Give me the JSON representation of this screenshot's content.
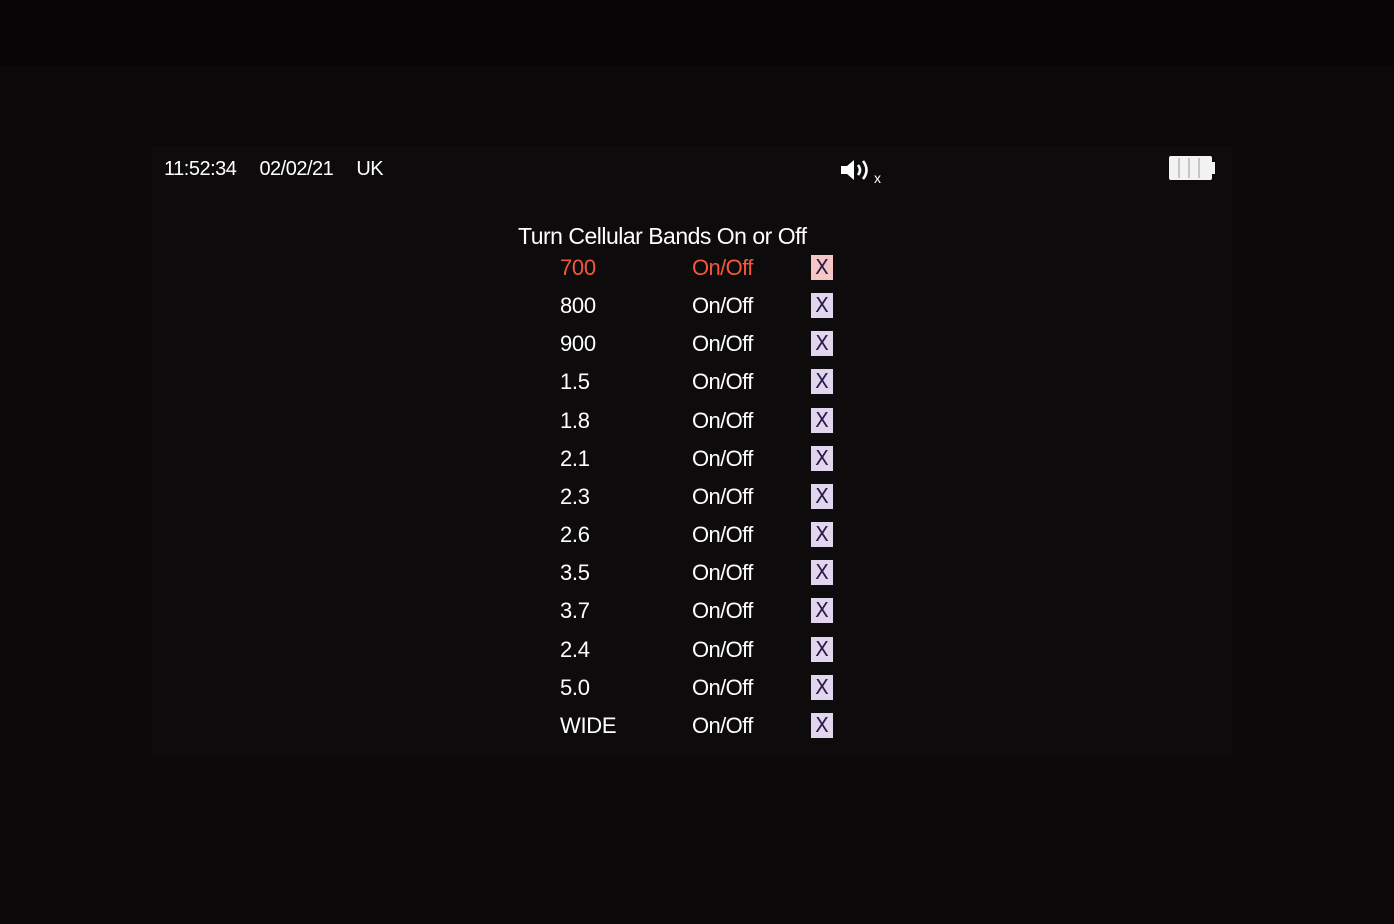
{
  "status_bar": {
    "time": "11:52:34",
    "date": "02/02/21",
    "region": "UK",
    "sound_icon": "speaker-muted-icon",
    "battery_icon": "battery-icon"
  },
  "title": "Turn Cellular Bands On or Off",
  "bands": [
    {
      "band": "700",
      "toggle": "On/Off",
      "mark": "X",
      "selected": true
    },
    {
      "band": "800",
      "toggle": "On/Off",
      "mark": "X",
      "selected": false
    },
    {
      "band": "900",
      "toggle": "On/Off",
      "mark": "X",
      "selected": false
    },
    {
      "band": "1.5",
      "toggle": "On/Off",
      "mark": "X",
      "selected": false
    },
    {
      "band": "1.8",
      "toggle": "On/Off",
      "mark": "X",
      "selected": false
    },
    {
      "band": "2.1",
      "toggle": "On/Off",
      "mark": "X",
      "selected": false
    },
    {
      "band": "2.3",
      "toggle": "On/Off",
      "mark": "X",
      "selected": false
    },
    {
      "band": "2.6",
      "toggle": "On/Off",
      "mark": "X",
      "selected": false
    },
    {
      "band": "3.5",
      "toggle": "On/Off",
      "mark": "X",
      "selected": false
    },
    {
      "band": "3.7",
      "toggle": "On/Off",
      "mark": "X",
      "selected": false
    },
    {
      "band": "2.4",
      "toggle": "On/Off",
      "mark": "X",
      "selected": false
    },
    {
      "band": "5.0",
      "toggle": "On/Off",
      "mark": "X",
      "selected": false
    },
    {
      "band": "WIDE",
      "toggle": "On/Off",
      "mark": "X",
      "selected": false
    }
  ],
  "colors": {
    "selected_text": "#f4573d",
    "normal_text": "#ffffff",
    "checkbox_bg": "#e2d6ee",
    "checkbox_selected_bg": "#f4c6c6",
    "background": "#0c0809"
  }
}
